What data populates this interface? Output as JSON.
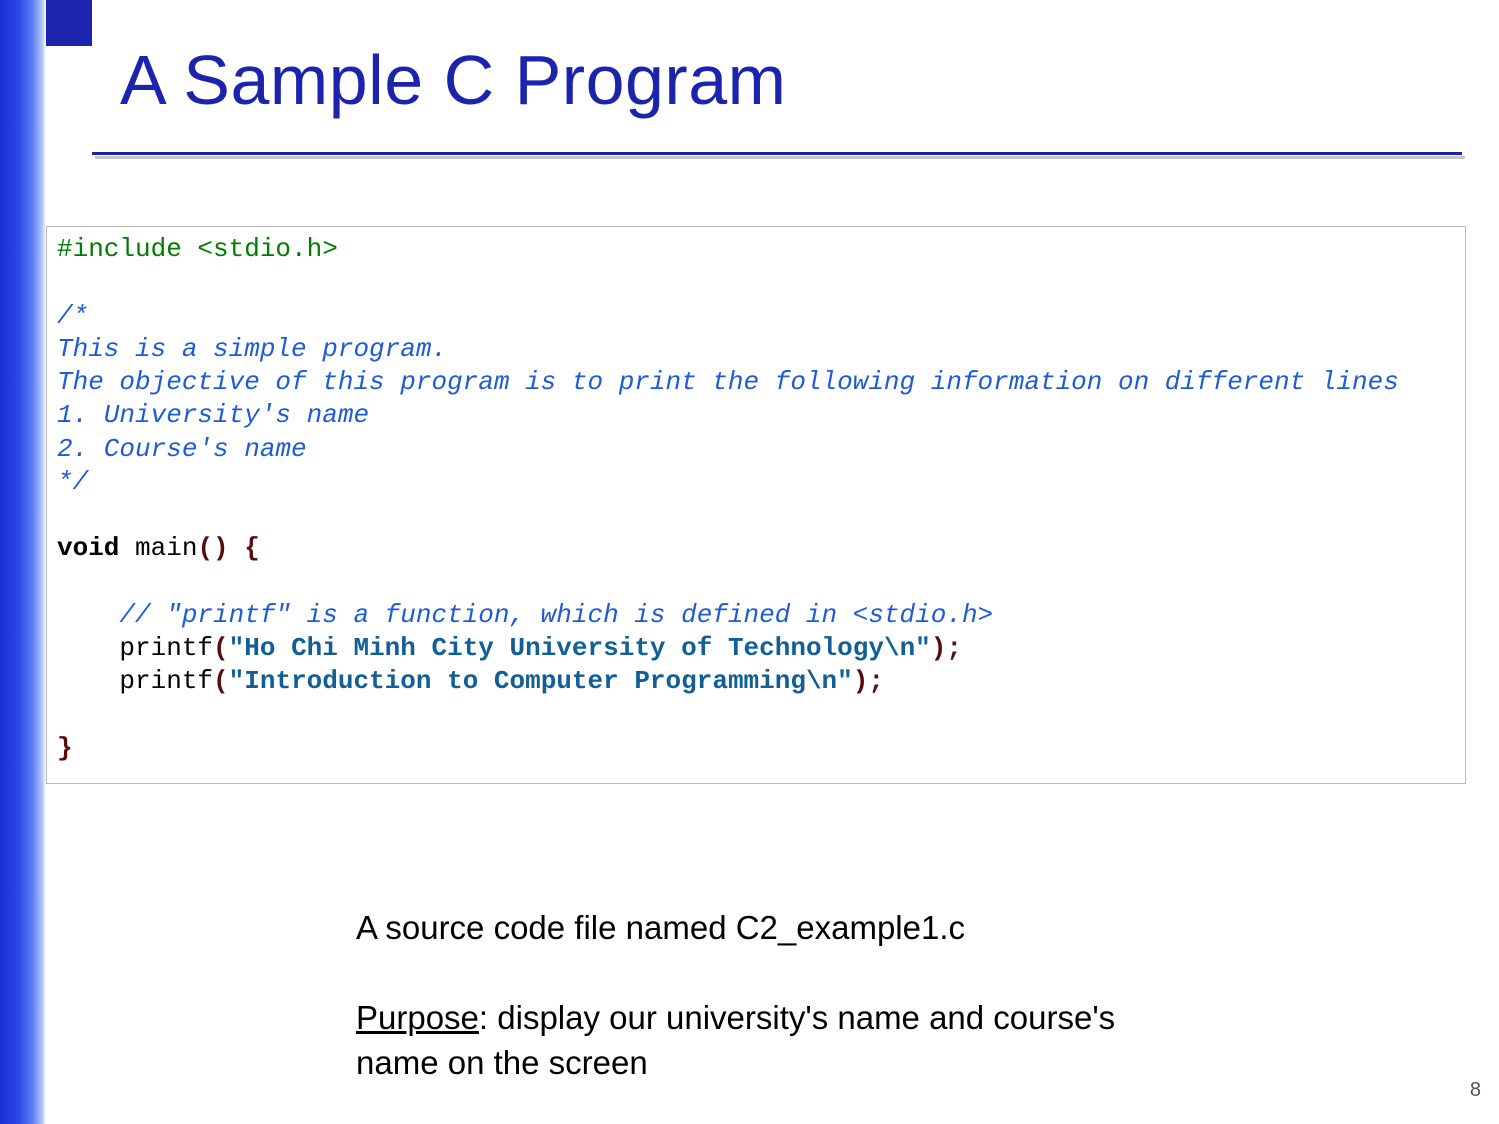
{
  "slide": {
    "title": "A Sample C Program",
    "page_number": "8",
    "caption_line1": "A source code file named C2_example1.c",
    "caption_purpose_label": "Purpose",
    "caption_purpose_text": ": display our university's name and course's name on the screen"
  },
  "code": {
    "include": "#include <stdio.h>",
    "comment_open": "/*",
    "comment_l1": "This is a simple program.",
    "comment_l2": "The objective of this program is to print the following information on different lines",
    "comment_l3": "1. University's name",
    "comment_l4": "2. Course's name",
    "comment_close": "*/",
    "kw_void": "void",
    "fn_main": " main",
    "paren_open": "(",
    "paren_close": ")",
    "brace_open": " {",
    "brace_close": "}",
    "inline_comment": "    // \"printf\" is a function, which is defined in <stdio.h>",
    "indent": "    ",
    "printf": "printf",
    "call_open": "(",
    "str1": "\"Ho Chi Minh City University of Technology\\n\"",
    "str2": "\"Introduction to Computer Programming\\n\"",
    "call_close_semi": ");"
  },
  "colors": {
    "accent": "#1c24ae",
    "preproc": "#007d00",
    "comment": "#1e5bd6",
    "string": "#125f97",
    "punct": "#5a0c0c"
  }
}
